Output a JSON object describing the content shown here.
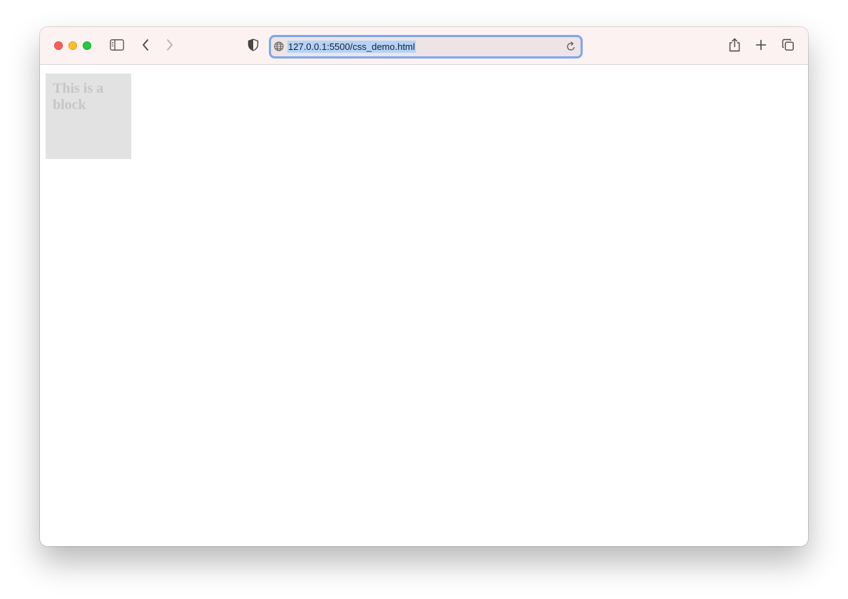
{
  "browser": {
    "url": "127.0.0.1:5500/css_demo.html",
    "toolbar": {
      "sidebar_icon": "sidebar-icon",
      "back_icon": "chevron-left-icon",
      "forward_icon": "chevron-right-icon",
      "privacy_icon": "shield-icon",
      "share_icon": "share-icon",
      "new_tab_icon": "plus-icon",
      "tabs_overview_icon": "tabs-overview-icon",
      "site_icon": "globe-icon",
      "reload_icon": "reload-icon"
    },
    "colors": {
      "close": "#fe5f57",
      "minimize": "#febc2e",
      "zoom": "#28c840",
      "url_focus_ring": "#7ea7ec",
      "url_selection": "#b3d3fb"
    }
  },
  "page": {
    "block_text": "This is a block",
    "block_background": "#e2e2e2",
    "block_text_color": "#c6c6c6"
  }
}
